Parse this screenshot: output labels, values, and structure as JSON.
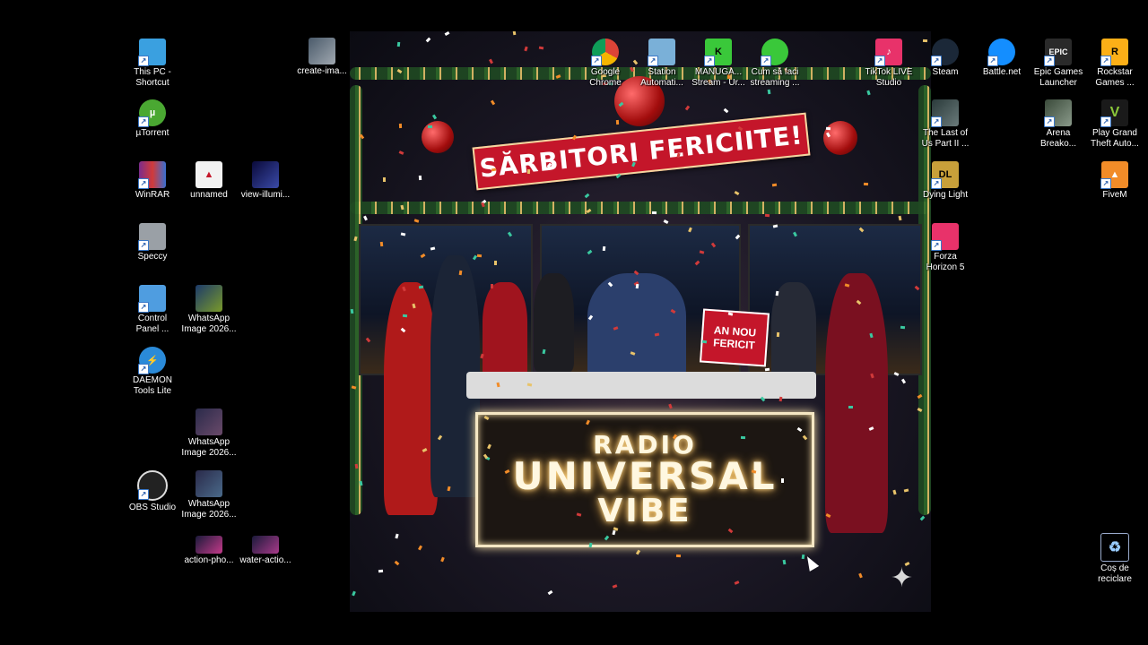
{
  "wallpaper": {
    "banner": "SĂRBITORI FERICIITE!",
    "sign_line1": "AN NOU",
    "sign_line2": "FERICIT",
    "neon_line1": "RADIO",
    "neon_line2": "UNIVERSAL",
    "neon_line3": "VIBE"
  },
  "icons": {
    "this_pc": "This PC -\nShortcut",
    "utorrent": "µTorrent",
    "winrar": "WinRAR",
    "speccy": "Speccy",
    "control_panel": "Control\nPanel ...",
    "daemon_tools": "DAEMON\nTools Lite",
    "obs": "OBS Studio",
    "create_ima": "create-ima...",
    "unnamed": "unnamed",
    "view_illumi": "view-illumi...",
    "whatsapp1": "WhatsApp\nImage 2026...",
    "whatsapp2": "WhatsApp\nImage 2026...",
    "whatsapp3": "WhatsApp\nImage 2026...",
    "action_pho": "action-pho...",
    "water_actio": "water-actio...",
    "chrome": "Google\nChrome",
    "station": "Station\nAutomati...",
    "manuga": "MANUGA...\nStream - Ur...",
    "cum_sa_faci": "Cum să faci\nstreaming ...",
    "tiktok": "TikTok LIVE\nStudio",
    "steam": "Steam",
    "battlenet": "Battle.net",
    "epic": "Epic Games\nLauncher",
    "rockstar": "Rockstar\nGames ...",
    "last_of_us": "The Last of\nUs Part II ...",
    "arena": "Arena\nBreako...",
    "gta": "Play Grand\nTheft Auto...",
    "dying_light": "Dying Light",
    "fivem": "FiveM",
    "forza": "Forza\nHorizon 5",
    "recycle": "Coș de\nreciclare"
  },
  "colors": {
    "desktop_bg": "#000000",
    "banner_red": "#c4162a",
    "neon_glow": "#ffd98a"
  }
}
